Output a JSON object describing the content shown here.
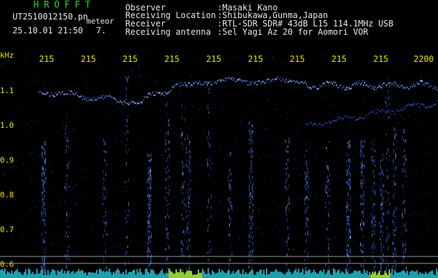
{
  "header": {
    "title": "HROFFT",
    "filename": "UT2510012150.pn",
    "meteor_label": "meteor",
    "datetime": "25.10.01 21:50",
    "count": "7.",
    "fields": [
      {
        "label": "Observer",
        "value": ":Masaki Kano"
      },
      {
        "label": "Receiving Location",
        "value": ":Shibukawa,Gunma,Japan"
      },
      {
        "label": "Receiver",
        "value": ":RTL-SDR SDR# 43dB L15 114.1MHz USB"
      },
      {
        "label": "Receiving antenna",
        "value": ":5el Yagi Az 20 for Aomori VOR"
      }
    ]
  },
  "axes": {
    "y_unit": "kHz",
    "y_ticks": [
      "1.1",
      "1.0",
      "0.9",
      "0.8",
      "0.7",
      "0.6"
    ],
    "x_ticks": [
      "215",
      "215",
      "215",
      "215",
      "215",
      "215",
      "215",
      "215",
      "215",
      "2200"
    ]
  },
  "colors": {
    "background": "#000000",
    "signal": "#3a6bff",
    "axis_text": "#e6e600",
    "title": "#2bd42b"
  }
}
